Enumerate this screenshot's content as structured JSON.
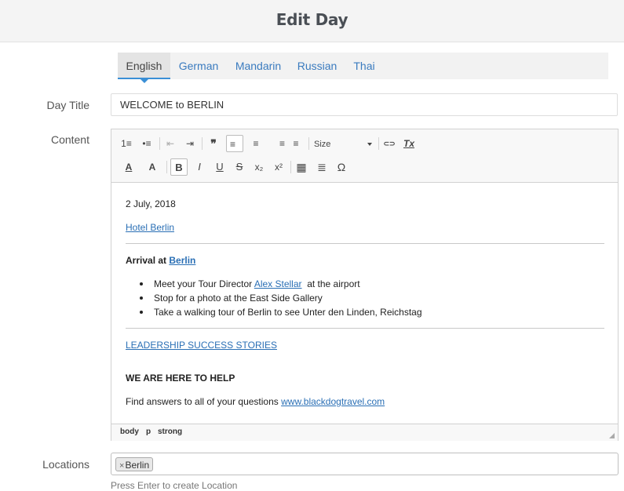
{
  "header": {
    "title": "Edit Day"
  },
  "tabs": [
    "English",
    "German",
    "Mandarin",
    "Russian",
    "Thai"
  ],
  "labels": {
    "day_title": "Day Title",
    "content": "Content",
    "locations": "Locations"
  },
  "day_title_value": "WELCOME to BERLIN",
  "toolbar": {
    "size_label": "Size",
    "glyphs": {
      "numbered_list": "1≡",
      "bullet_list": "•≡",
      "outdent": "⇤",
      "indent": "⇥",
      "blockquote": "❞",
      "align_left": "≡",
      "align_center": "≡",
      "align_right": "≡",
      "justify": "≡",
      "link": "⊂⊃",
      "remove_format": "Tx",
      "text_color": "A",
      "bg_color": "A",
      "bold": "B",
      "italic": "I",
      "underline": "U",
      "strike": "S",
      "subscript": "x₂",
      "superscript": "x²",
      "table": "▦",
      "hr": "≣",
      "special_char": "Ω"
    }
  },
  "content": {
    "date": "2 July, 2018",
    "hotel_link": "Hotel Berlin",
    "arrival_prefix": "Arrival at",
    "arrival_link": "Berlin",
    "bullets": {
      "item1_prefix": "Meet your Tour Director",
      "item1_link": "Alex Stellar",
      "item1_suffix": "at the airport",
      "item2": "Stop for a photo at the East Side Gallery",
      "item3": "Take a walking tour of Berlin to see Unter den Linden, Reichstag"
    },
    "leadership_link": "LEADERSHIP SUCCESS STORIES",
    "help_heading": "WE ARE HERE TO HELP",
    "find_prefix": "Find answers to all of your questions",
    "website_link": "www.blackdogtravel.com"
  },
  "statusbar": {
    "path": [
      "body",
      "p",
      "strong"
    ]
  },
  "locations": {
    "chips": [
      "Berlin"
    ],
    "remove_glyph": "×",
    "hint": "Press Enter to create Location"
  }
}
